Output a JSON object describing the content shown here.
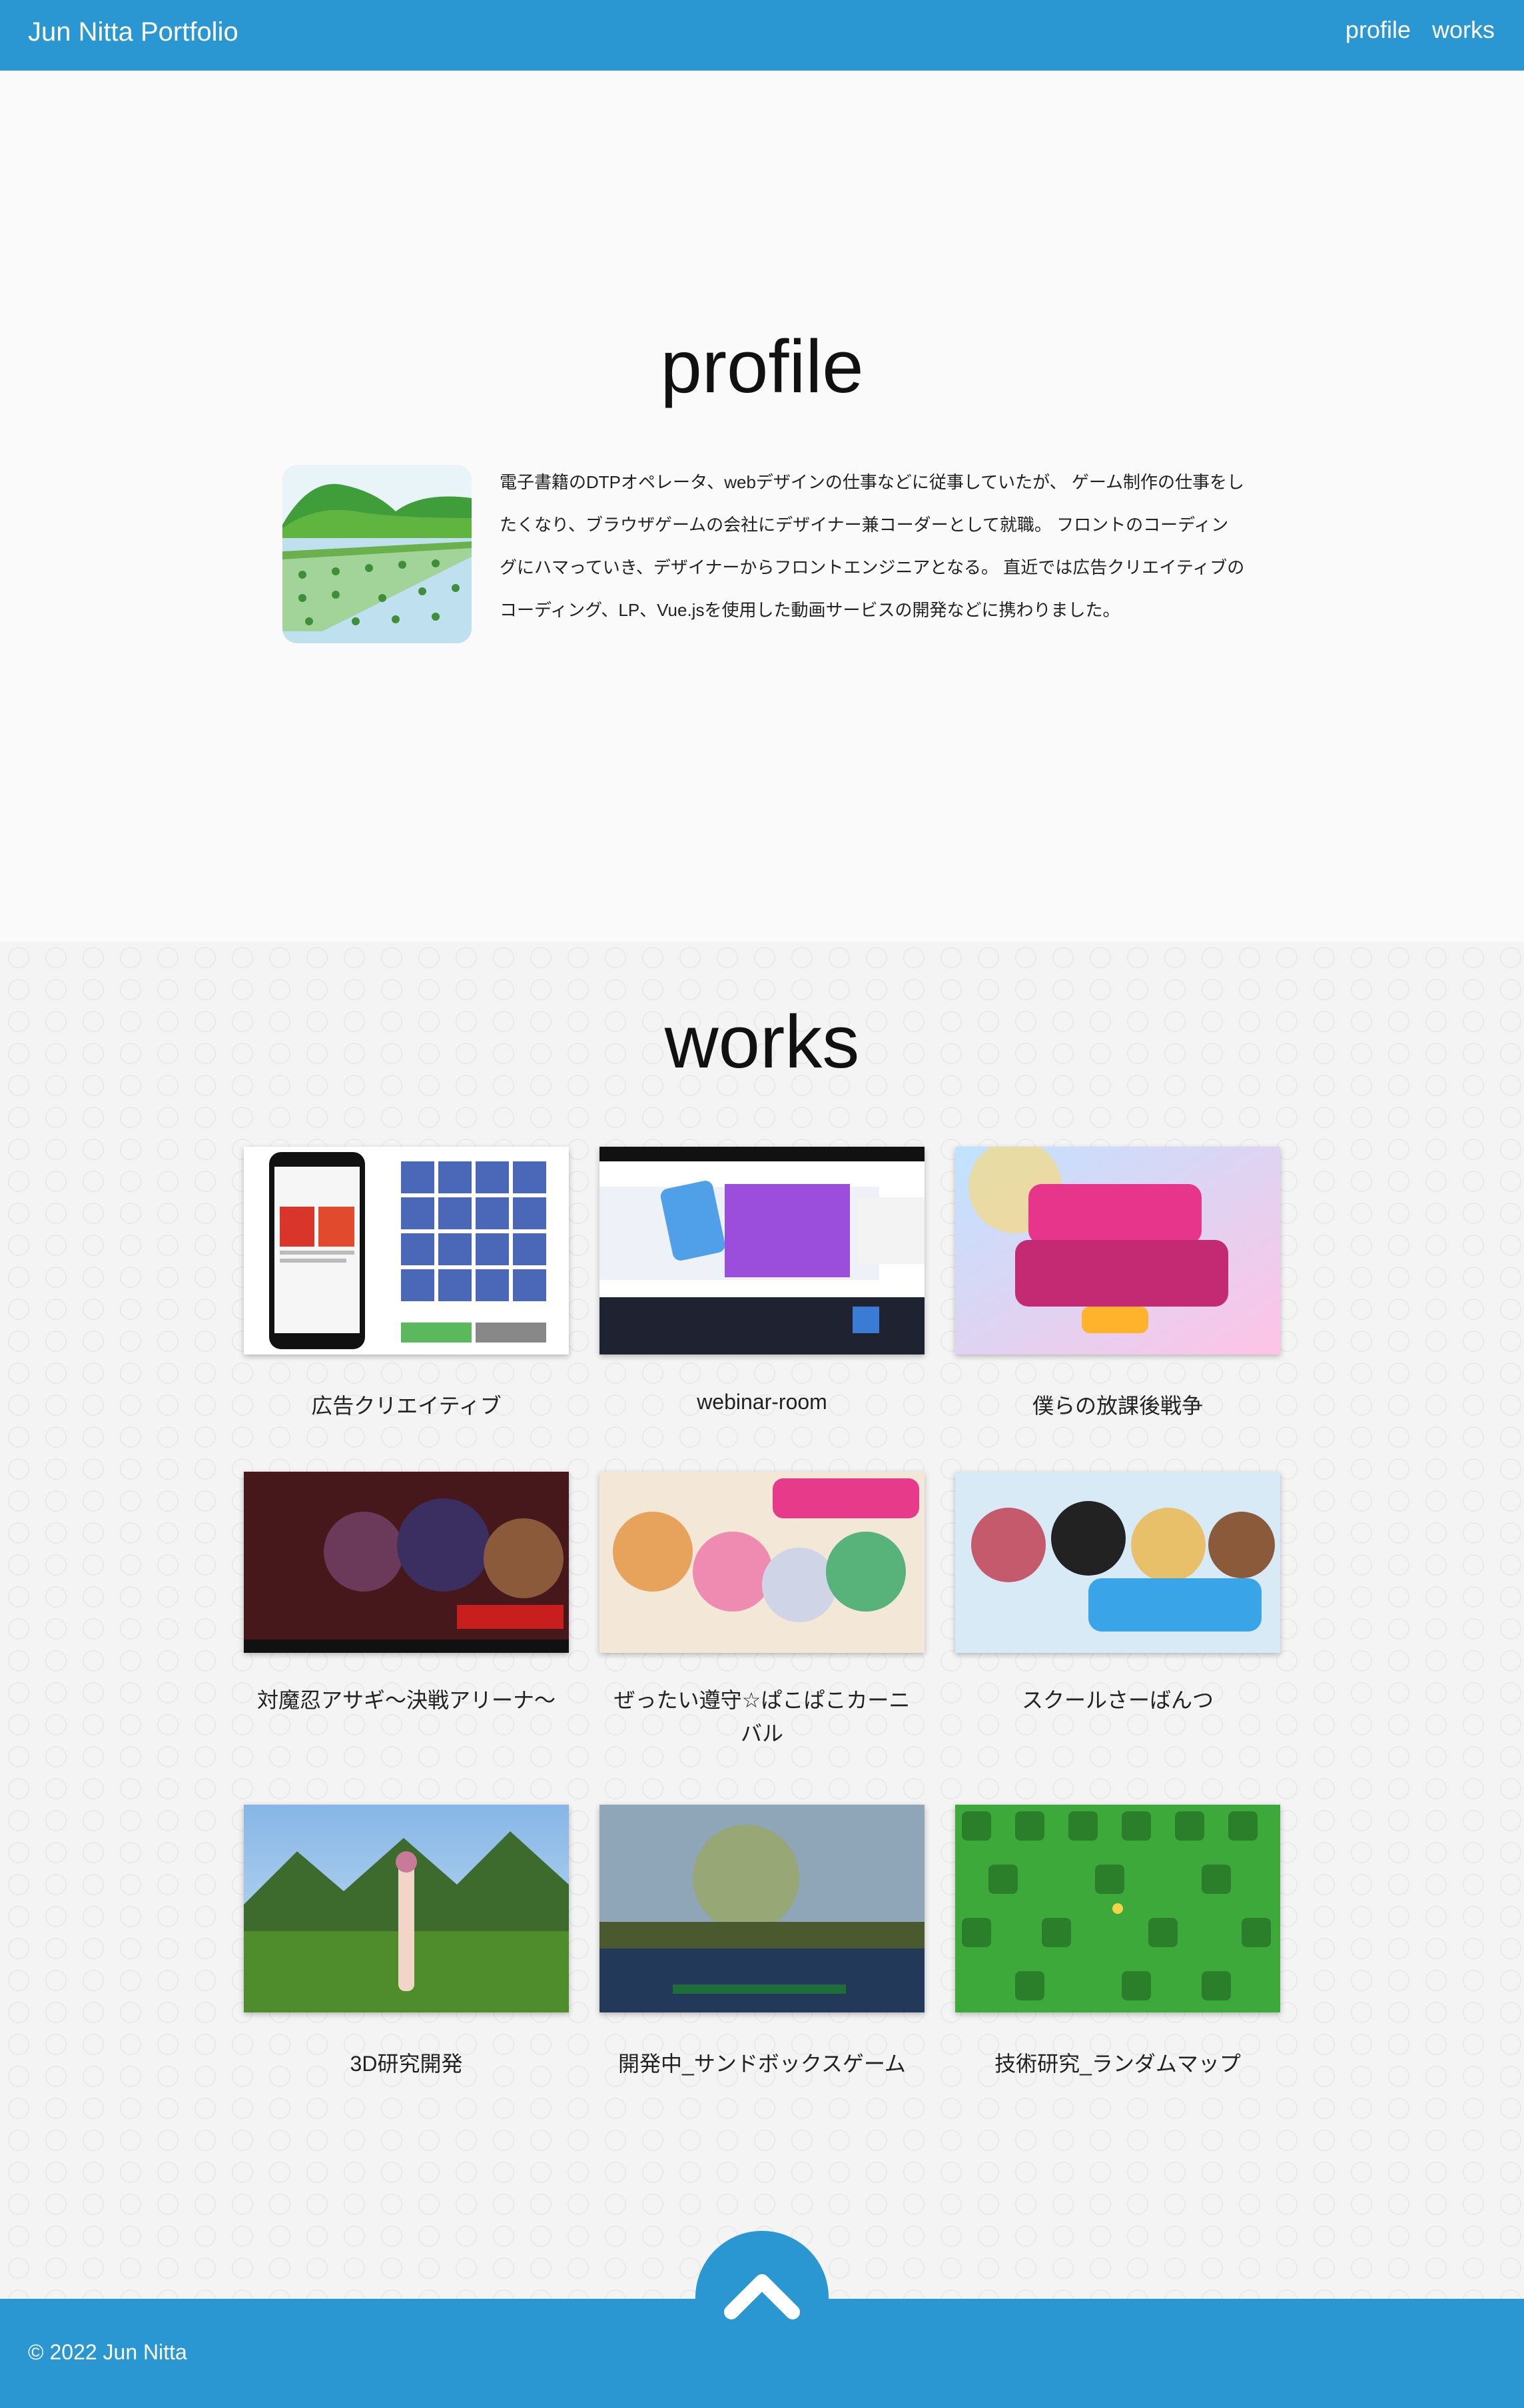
{
  "header": {
    "brand": "Jun Nitta Portfolio",
    "nav": [
      "profile",
      "works"
    ],
    "color": "#2a97d3"
  },
  "profile": {
    "title": "profile",
    "image": "rice-field-illustration",
    "bio": "電子書籍のDTPオペレータ、webデザインの仕事などに従事していたが、 ゲーム制作の仕事をしたくなり、ブラウザゲームの会社にデザイナー兼コーダーとして就職。 フロントのコーディングにハマっていき、デザイナーからフロントエンジニアとなる。 直近では広告クリエイティブのコーディング、LP、Vue.jsを使用した動画サービスの開発などに携わりました。"
  },
  "works": {
    "title": "works",
    "items": [
      {
        "label": "広告クリエイティブ",
        "thumb": "ad-creative-screenshot"
      },
      {
        "label": "webinar-room",
        "thumb": "webinar-room-screenshot"
      },
      {
        "label": "僕らの放課後戦争",
        "thumb": "after-school-wars-title"
      },
      {
        "label": "対魔忍アサギ〜決戦アリーナ〜",
        "thumb": "taimanin-asagi-title"
      },
      {
        "label": "ぜったい遵守☆ぱこぱこカーニバル",
        "thumb": "carnival-title"
      },
      {
        "label": "スクールさーばんつ",
        "thumb": "school-servants-title"
      },
      {
        "label": "3D研究開発",
        "thumb": "3d-research-screenshot"
      },
      {
        "label": "開発中_サンドボックスゲーム",
        "thumb": "sandbox-game-screenshot"
      },
      {
        "label": "技術研究_ランダムマップ",
        "thumb": "random-map-screenshot"
      }
    ]
  },
  "footer": {
    "copyright": "© 2022 Jun Nitta",
    "to_top_icon": "chevron-up-icon"
  }
}
